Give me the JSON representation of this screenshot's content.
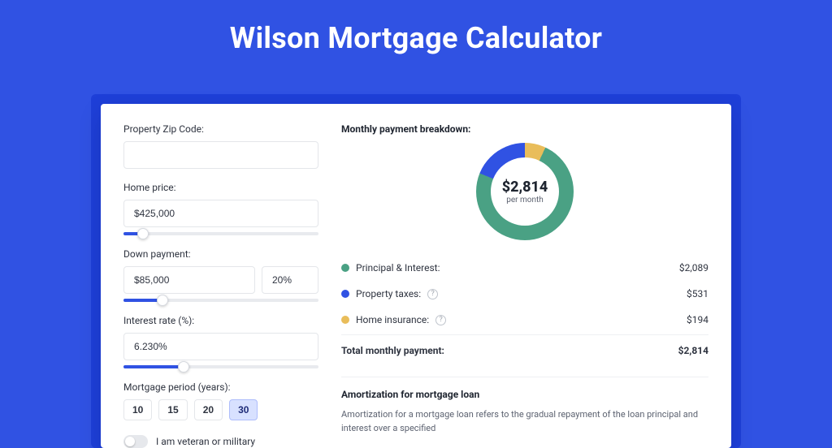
{
  "hero": {
    "title": "Wilson Mortgage Calculator"
  },
  "form": {
    "zip_label": "Property Zip Code:",
    "zip_value": "",
    "home_price_label": "Home price:",
    "home_price_value": "$425,000",
    "down_label": "Down payment:",
    "down_value": "$85,000",
    "down_pct": "20%",
    "rate_label": "Interest rate (%):",
    "rate_value": "6.230%",
    "period_label": "Mortgage period (years):",
    "periods": {
      "p0": "10",
      "p1": "15",
      "p2": "20",
      "p3": "30"
    },
    "veteran_label": "I am veteran or military"
  },
  "breakdown": {
    "title": "Monthly payment breakdown:",
    "center_value": "$2,814",
    "center_sub": "per month",
    "pi_label": "Principal & Interest:",
    "pi_value": "$2,089",
    "tax_label": "Property taxes:",
    "tax_value": "$531",
    "ins_label": "Home insurance:",
    "ins_value": "$194",
    "total_label": "Total monthly payment:",
    "total_value": "$2,814"
  },
  "amort": {
    "title": "Amortization for mortgage loan",
    "desc": "Amortization for a mortgage loan refers to the gradual repayment of the loan principal and interest over a specified"
  },
  "chart_data": {
    "type": "pie",
    "title": "Monthly payment breakdown",
    "series": [
      {
        "name": "Principal & Interest",
        "value": 2089,
        "color": "#4aa184"
      },
      {
        "name": "Property taxes",
        "value": 531,
        "color": "#3052e3"
      },
      {
        "name": "Home insurance",
        "value": 194,
        "color": "#e9bd5a"
      }
    ],
    "total": 2814,
    "center_label": "$2,814 per month"
  }
}
